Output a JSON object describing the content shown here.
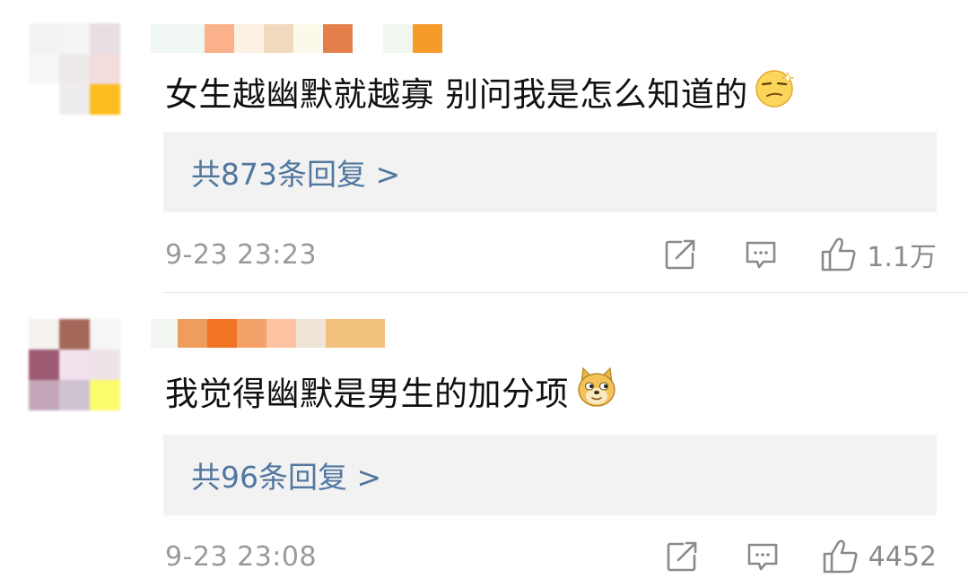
{
  "comments": [
    {
      "text": "女生越幽默就越寡 别问我是怎么知道的",
      "emoji": "smirk-face-icon",
      "reply_label": "共873条回复 >",
      "time": "9-23 23:23",
      "likes": "1.1万"
    },
    {
      "text": "我觉得幽默是男生的加分项",
      "emoji": "doge-icon",
      "reply_label": "共96条回复 >",
      "time": "9-23 23:08",
      "likes": "4452"
    }
  ],
  "icons": {
    "share": "share-icon",
    "comment": "comment-icon",
    "like": "thumbs-up-icon"
  },
  "colors": {
    "reply_link": "#52779f",
    "reply_bg": "#f2f2f2",
    "meta_text": "#9a9a9a"
  }
}
